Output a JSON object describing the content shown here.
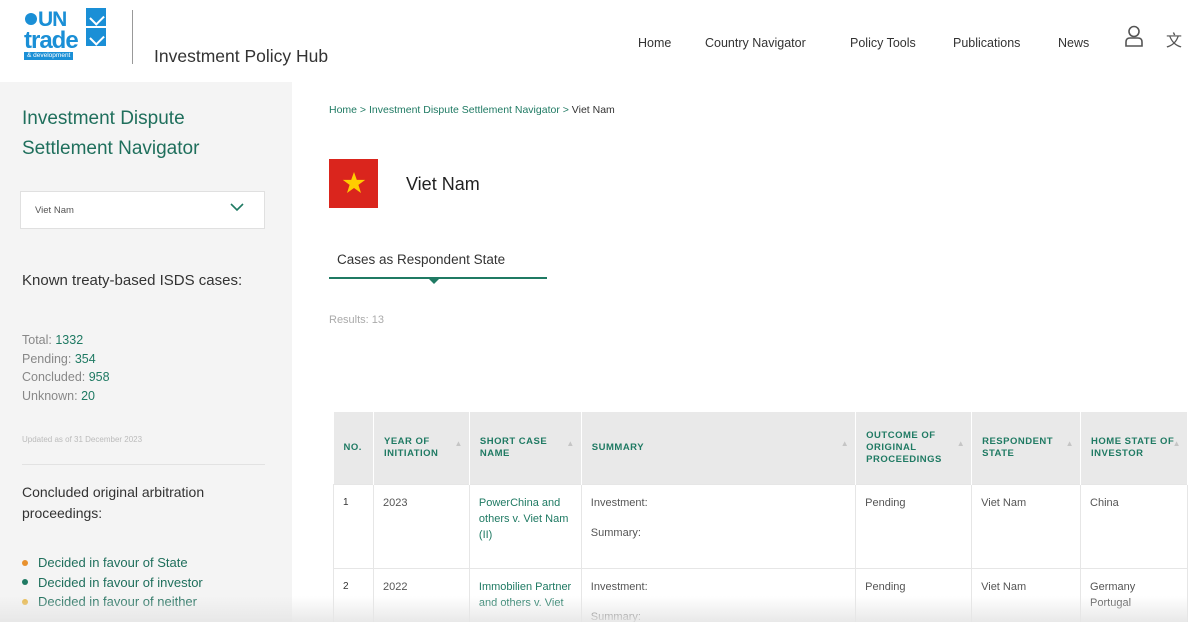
{
  "header": {
    "logo": {
      "un": "UN",
      "trade": "trade",
      "dev": "& development"
    },
    "hub_title": "Investment Policy Hub",
    "nav": [
      "Home",
      "Country Navigator",
      "Policy Tools",
      "Publications",
      "News"
    ]
  },
  "sidebar": {
    "title": "Investment Dispute Settlement Navigator",
    "select_value": "Viet Nam",
    "known_title": "Known treaty-based ISDS cases:",
    "stats": [
      {
        "label": "Total: ",
        "value": "1332"
      },
      {
        "label": "Pending: ",
        "value": "354"
      },
      {
        "label": "Concluded: ",
        "value": "958"
      },
      {
        "label": "Unknown: ",
        "value": "20"
      }
    ],
    "updated": "Updated as of 31 December 2023",
    "concluded_title": "Concluded original arbitration proceedings:",
    "legend": [
      {
        "label": "Decided in favour of State",
        "color": "#e8912e"
      },
      {
        "label": "Decided in favour of investor",
        "color": "#1f7a63"
      },
      {
        "label": "Decided in favour of neither",
        "color": "#e8b84a"
      }
    ]
  },
  "main": {
    "breadcrumb": {
      "home": "Home",
      "sep": " > ",
      "section": "Investment Dispute Settlement Navigator",
      "current": "Viet Nam"
    },
    "country": "Viet Nam",
    "tab": "Cases as Respondent State",
    "results": "Results: 13",
    "table": {
      "headers": [
        "NO.",
        "YEAR OF INITIATION",
        "SHORT CASE NAME",
        "SUMMARY",
        "OUTCOME OF ORIGINAL PROCEEDINGS",
        "RESPONDENT STATE",
        "HOME STATE OF INVESTOR"
      ],
      "rows": [
        {
          "no": "1",
          "year": "2023",
          "name": "PowerChina and others v. Viet Nam (II)",
          "summary1": "Investment:",
          "summary2": "Summary:",
          "outcome": "Pending",
          "respondent": "Viet Nam",
          "home": "China"
        },
        {
          "no": "2",
          "year": "2022",
          "name": "Immobilien Partner and others v. Viet",
          "summary1": "Investment:",
          "summary2": "Summary:",
          "outcome": "Pending",
          "respondent": "Viet Nam",
          "home": "Germany Portugal"
        }
      ]
    }
  }
}
